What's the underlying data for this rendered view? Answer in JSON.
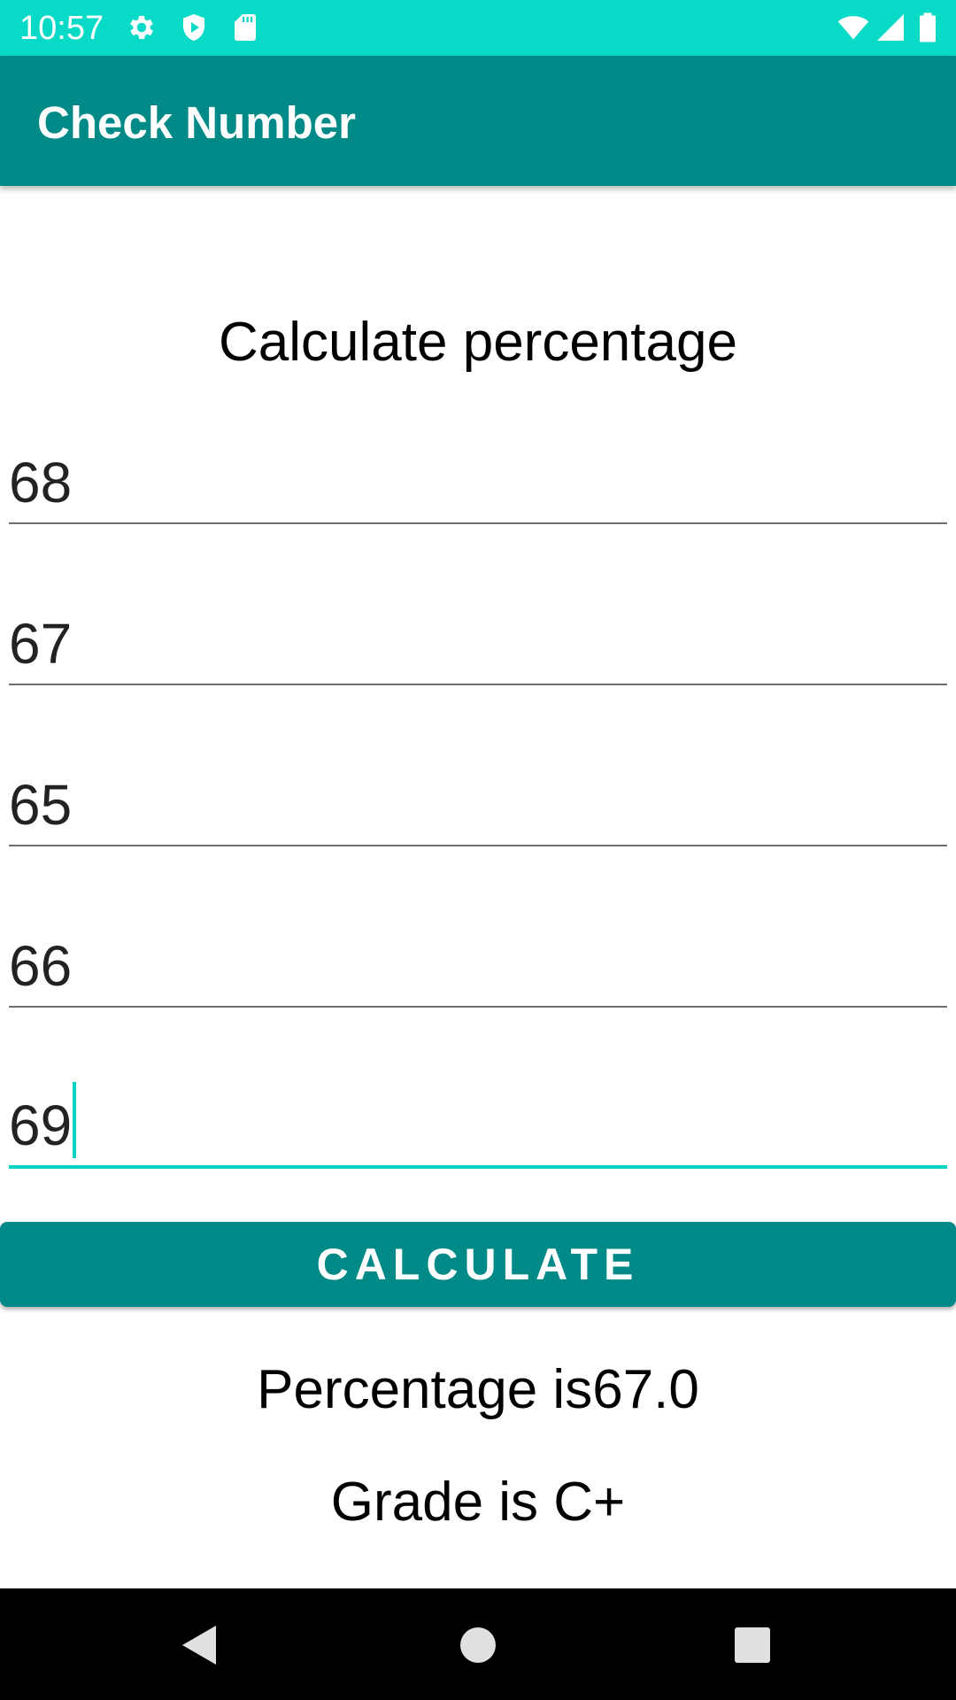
{
  "status_bar": {
    "time": "10:57",
    "left_icons": [
      "gear-icon",
      "shield-icon",
      "sd-card-icon"
    ],
    "right_icons": [
      "wifi-icon",
      "signal-icon",
      "battery-icon"
    ],
    "background_color": "#07dbc8"
  },
  "app_bar": {
    "title": "Check Number",
    "background_color": "#008a87"
  },
  "main": {
    "heading": "Calculate percentage",
    "inputs": [
      {
        "value": "68"
      },
      {
        "value": "67"
      },
      {
        "value": "65"
      },
      {
        "value": "66"
      },
      {
        "value": "69",
        "focused": true
      }
    ],
    "calculate_button_label": "CALCULATE",
    "percentage_result": "Percentage is67.0",
    "grade_result": "Grade is C+"
  },
  "nav_bar": {
    "buttons": [
      "back-icon",
      "home-icon",
      "recents-icon"
    ]
  },
  "colors": {
    "accent": "#07d3c2",
    "primary": "#008a87"
  }
}
